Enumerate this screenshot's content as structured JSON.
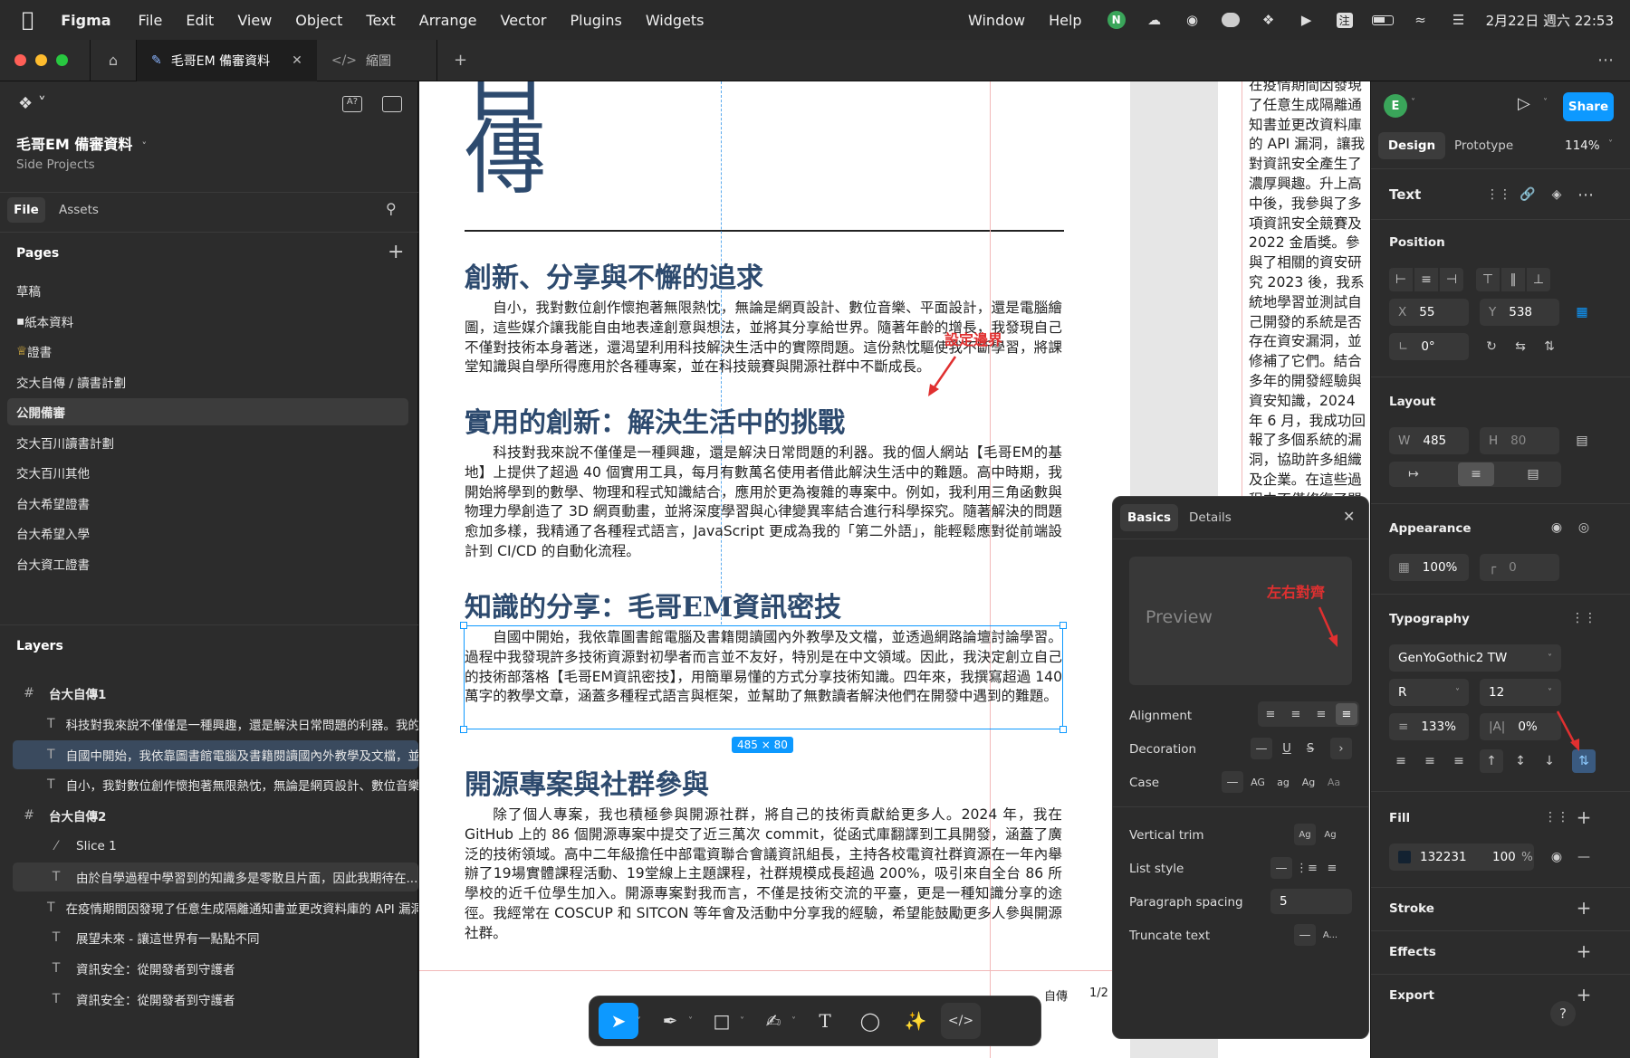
{
  "menubar": {
    "app": "Figma",
    "menus": [
      "File",
      "Edit",
      "View",
      "Object",
      "Text",
      "Arrange",
      "Vector",
      "Plugins",
      "Widgets"
    ],
    "right_menus": [
      "Window",
      "Help"
    ],
    "date": "2月22日 週六 22:53",
    "ime": "注"
  },
  "tabs": {
    "active": "毛哥EM 備審資料",
    "second": "縮圖"
  },
  "file": {
    "name": "毛哥EM 備審資料",
    "project": "Side Projects",
    "tab_file": "File",
    "tab_assets": "Assets"
  },
  "pages": {
    "header": "Pages",
    "items": [
      "草稿",
      "紙本資料",
      "證書",
      "交大自傳 / 讀書計劃",
      "公開備審",
      "交大百川讀書計劃",
      "交大百川其他",
      "台大希望證書",
      "台大希望入學",
      "台大資工證書"
    ],
    "selected_index": 4
  },
  "layers": {
    "header": "Layers",
    "items": [
      {
        "type": "#",
        "label": "台大自傳1",
        "indent": 0
      },
      {
        "type": "T",
        "label": "科技對我來說不僅僅是一種興趣，還是解決日常問題的利器。我的個人網站",
        "indent": 1
      },
      {
        "type": "T",
        "label": "自國中開始，我依靠圖書館電腦及書籍閱讀國內外教學及文檔，並透過",
        "indent": 1,
        "selected": true
      },
      {
        "type": "T",
        "label": "自小，我對數位創作懷抱著無限熱忱，無論是網頁設計、數位音樂、平面設計",
        "indent": 1
      },
      {
        "type": "#",
        "label": "台大自傳2",
        "indent": 0
      },
      {
        "type": "slice",
        "label": "Slice 1",
        "indent": 1
      },
      {
        "type": "T",
        "label": "由於自學過程中學習到的知識多是零散且片面，因此我期待在...",
        "indent": 1,
        "hover": true
      },
      {
        "type": "T",
        "label": "在疫情期間因發現了任意生成隔離通知書並更改資料庫的 API 漏洞",
        "indent": 1
      },
      {
        "type": "T",
        "label": "展望未來 - 讓這世界有一點點不同",
        "indent": 1
      },
      {
        "type": "T",
        "label": "資訊安全：從開發者到守護者",
        "indent": 1
      },
      {
        "type": "T",
        "label": "資訊安全：從開發者到守護者",
        "indent": 1
      }
    ]
  },
  "doc": {
    "big_char_top": "自",
    "big_char": "傳",
    "h1": "創新、分享與不懈的追求",
    "p1": "自小，我對數位創作懷抱著無限熱忱，無論是網頁設計、數位音樂、平面設計，還是電腦繪圖，這些媒介讓我能自由地表達創意與想法，並將其分享給世界。隨著年齡的增長，我發現自己不僅對技術本身著迷，還渴望利用科技解決生活中的實際問題。這份熱忱驅使我不斷學習，將課堂知識與自學所得應用於各種專案，並在科技競賽與開源社群中不斷成長。",
    "h2": "實用的創新：解決生活中的挑戰",
    "p2": "科技對我來說不僅僅是一種興趣，還是解決日常問題的利器。我的個人網站【毛哥EM的基地】上提供了超過 40 個實用工具，每月有數萬名使用者借此解決生活中的難題。高中時期，我開始將學到的數學、物理和程式知識結合，應用於更為複雜的專案中。例如，我利用三角函數與物理力學創造了 3D 網頁動畫，並將深度學習與心律變異率結合進行科學探究。隨著解決的問題愈加多樣，我精通了各種程式語言，JavaScript 更成為我的「第二外語」，能輕鬆應對從前端設計到 CI/CD 的自動化流程。",
    "h3": "知識的分享：毛哥EM資訊密技",
    "p3": "自國中開始，我依靠圖書館電腦及書籍閱讀國內外教學及文檔，並透過網路論壇討論學習。過程中我發現許多技術資源對初學者而言並不友好，特別是在中文領域。因此，我決定創立自己的技術部落格【毛哥EM資訊密技】，用簡單易懂的方式分享技術知識。四年來，我撰寫超過 140 萬字的教學文章，涵蓋多種程式語言與框架，並幫助了無數讀者解決他們在開發中遇到的難題。",
    "h4": "開源專案與社群參與",
    "p4": "除了個人專案，我也積極參與開源社群，將自己的技術貢獻給更多人。2024 年，我在 GitHub 上的 86 個開源專案中提交了近三萬次 commit，從函式庫翻譯到工具開發，涵蓋了廣泛的技術領域。高中二年級擔任中部電資聯合會議資訊組長，主持各校電資社群資源在一年內舉辦了19場實體課程活動、19堂線上主題課程，社群規模成長超過 200%，吸引來自全台 86 所學校的近千位學生加入。開源專案對我而言，不僅是技術交流的平臺，更是一種知識分享的途徑。我經常在 COSCUP 和 SITCON 等年會及活動中分享我的經驗，希望能鼓勵更多人參與開源社群。",
    "footer_label": "自傳",
    "footer_page": "1/2",
    "size_badge": "485 × 80",
    "p2_right": "在疫情期間因發現了任意生成隔離通知書並更改資料庫的 API 漏洞，讓我對資訊安全產生了濃厚興趣。升上高中後，我參與了多項資訊安全競賽及 2022 金盾獎。參與了相關的資安研究 2023 後，我系統地學習並測試自己開發的系統是否存在資安漏洞，並修補了它們。結合多年的開發經驗與資安知識，2024 年 6 月，我成功回報了多個系統的漏洞，協助許多組織及企業。在這些過程中不僅修復了問題，還保護了用戶的隱私。在研究資安的過程中，時間我進行了一系列觸控密碼；透過部分統，將文字訊息轉換來追蹤配戴者的的日動分析模型。只需要的數據，就能達到了其中的資安風險。在這些經歷中，開發習慣，這也是我"
  },
  "annotations": {
    "boundary": "設定邊界",
    "justify": "左右對齊"
  },
  "design": {
    "avatar": "E",
    "share": "Share",
    "tab_design": "Design",
    "tab_prototype": "Prototype",
    "zoom": "114%",
    "section_text": "Text",
    "position": "Position",
    "x_label": "X",
    "x": "55",
    "y_label": "Y",
    "y": "538",
    "rot": "0°",
    "layout": "Layout",
    "w_label": "W",
    "w": "485",
    "h_label": "H",
    "h": "80",
    "appearance": "Appearance",
    "opacity": "100%",
    "radius": "0",
    "typography": "Typography",
    "font": "GenYoGothic2 TW",
    "weight": "R",
    "size": "12",
    "line_height": "133%",
    "letter_spacing": "0%",
    "fill": "Fill",
    "fill_hex": "132231",
    "fill_opacity": "100",
    "fill_pct": "%",
    "stroke": "Stroke",
    "effects": "Effects",
    "export": "Export",
    "fill_color": "#132231"
  },
  "type_panel": {
    "tab_basics": "Basics",
    "tab_details": "Details",
    "preview": "Preview",
    "alignment": "Alignment",
    "decoration": "Decoration",
    "case": "Case",
    "vertical_trim": "Vertical trim",
    "list_style": "List style",
    "paragraph_spacing": "Paragraph spacing",
    "paragraph_spacing_value": "5",
    "truncate_text": "Truncate text",
    "case_ag1": "AG",
    "case_ag2": "ag",
    "case_ag3": "Ag",
    "case_ag4": "Aa",
    "truncate_a": "A..."
  },
  "colors": {
    "accent": "#0d99ff",
    "heading": "#2d4a6e",
    "annotation": "#e03030",
    "share": "#0d99ff"
  }
}
